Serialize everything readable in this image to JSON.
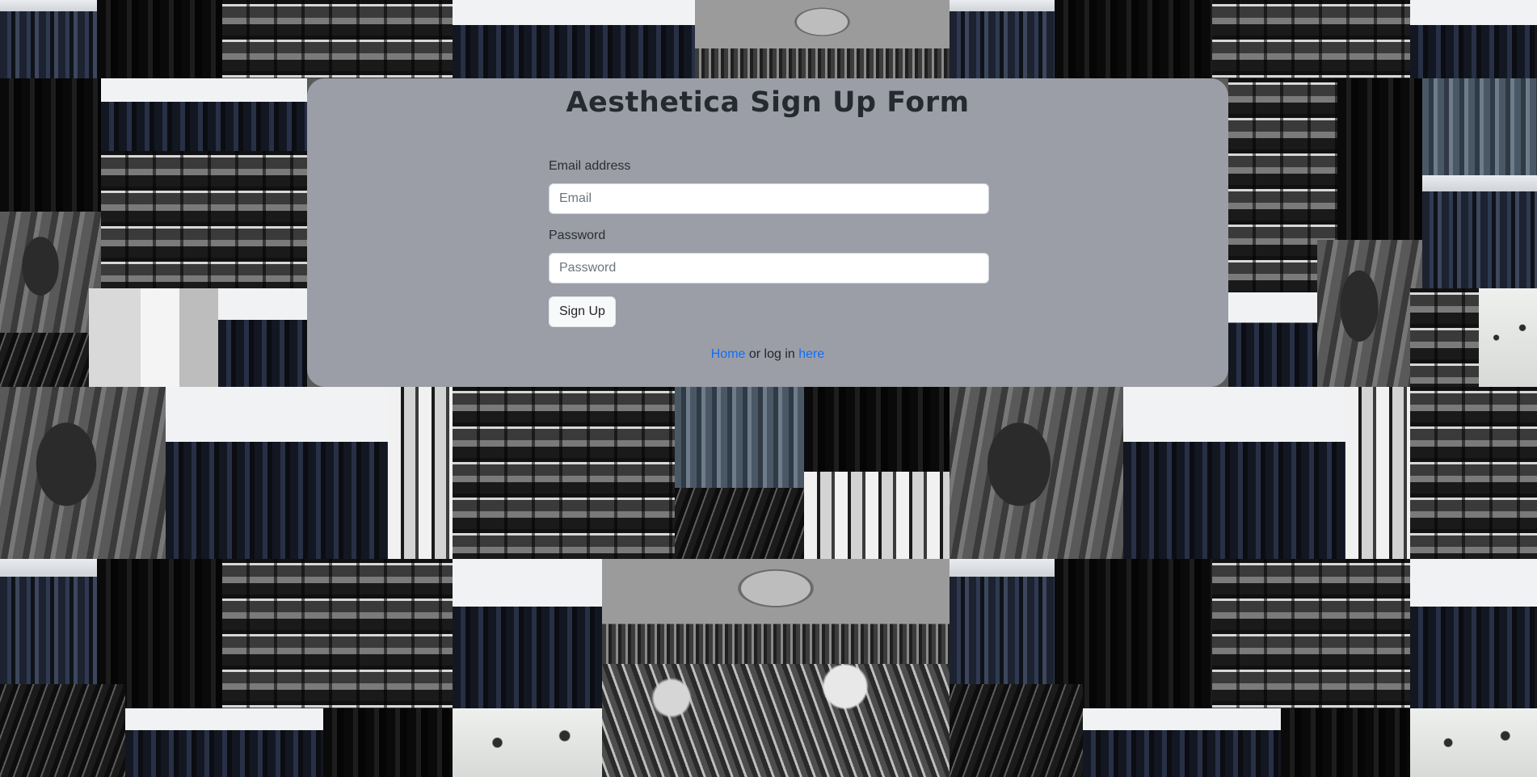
{
  "form": {
    "title": "Aesthetica Sign Up Form",
    "email_label": "Email address",
    "email_placeholder": "Email",
    "email_value": "",
    "password_label": "Password",
    "password_placeholder": "Password",
    "password_value": "",
    "submit_label": "Sign Up"
  },
  "footer": {
    "home_link": "Home",
    "middle_text": " or log in ",
    "login_link": "here"
  },
  "colors": {
    "card_background": "#9b9ea6",
    "link": "#0d6efd",
    "title_text": "#252a30"
  },
  "background": {
    "description_icons": [
      "clothing-rack-photo",
      "shelves-photo",
      "storefront-photo",
      "hangers-photo",
      "wall-lamp-photo"
    ]
  }
}
